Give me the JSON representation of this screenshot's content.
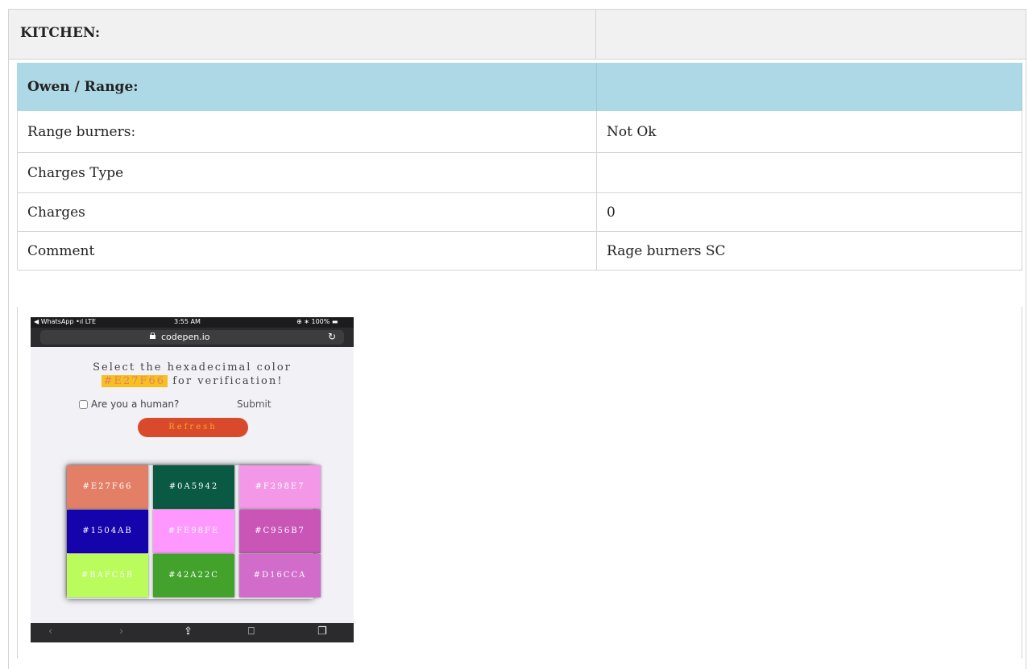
{
  "section": {
    "title": "KITCHEN:",
    "right": ""
  },
  "subsection": {
    "title": "Owen / Range:",
    "right": ""
  },
  "rows": [
    {
      "label": "Range burners:",
      "value": "Not Ok"
    },
    {
      "label": "Charges Type",
      "value": ""
    },
    {
      "label": "Charges",
      "value": "0"
    },
    {
      "label": "Comment",
      "value": "Rage burners SC"
    }
  ],
  "phone": {
    "status": {
      "app": "WhatsApp",
      "net": "LTE",
      "time": "3:55 AM",
      "battery": "100%"
    },
    "url": "codepen.io",
    "prompt_line1": "Select the hexadecimal color",
    "prompt_hex": "#E27F66",
    "prompt_line2_rest": "for verification!",
    "checkbox_label": "Are you a human?",
    "submit_label": "Submit",
    "refresh_label": "Refresh",
    "swatches": [
      {
        "label": "#E27F66",
        "color": "#e27f66"
      },
      {
        "label": "#0A5942",
        "color": "#0a5942"
      },
      {
        "label": "#F298E7",
        "color": "#f298e7"
      },
      {
        "label": "#1504AB",
        "color": "#1504ab"
      },
      {
        "label": "#FE98FE",
        "color": "#fe98fe"
      },
      {
        "label": "#C956B7",
        "color": "#c956b7"
      },
      {
        "label": "#BAFC5B",
        "color": "#bafc5b"
      },
      {
        "label": "#42A22C",
        "color": "#42a22c"
      },
      {
        "label": "#D16CCA",
        "color": "#d16cca"
      }
    ]
  }
}
